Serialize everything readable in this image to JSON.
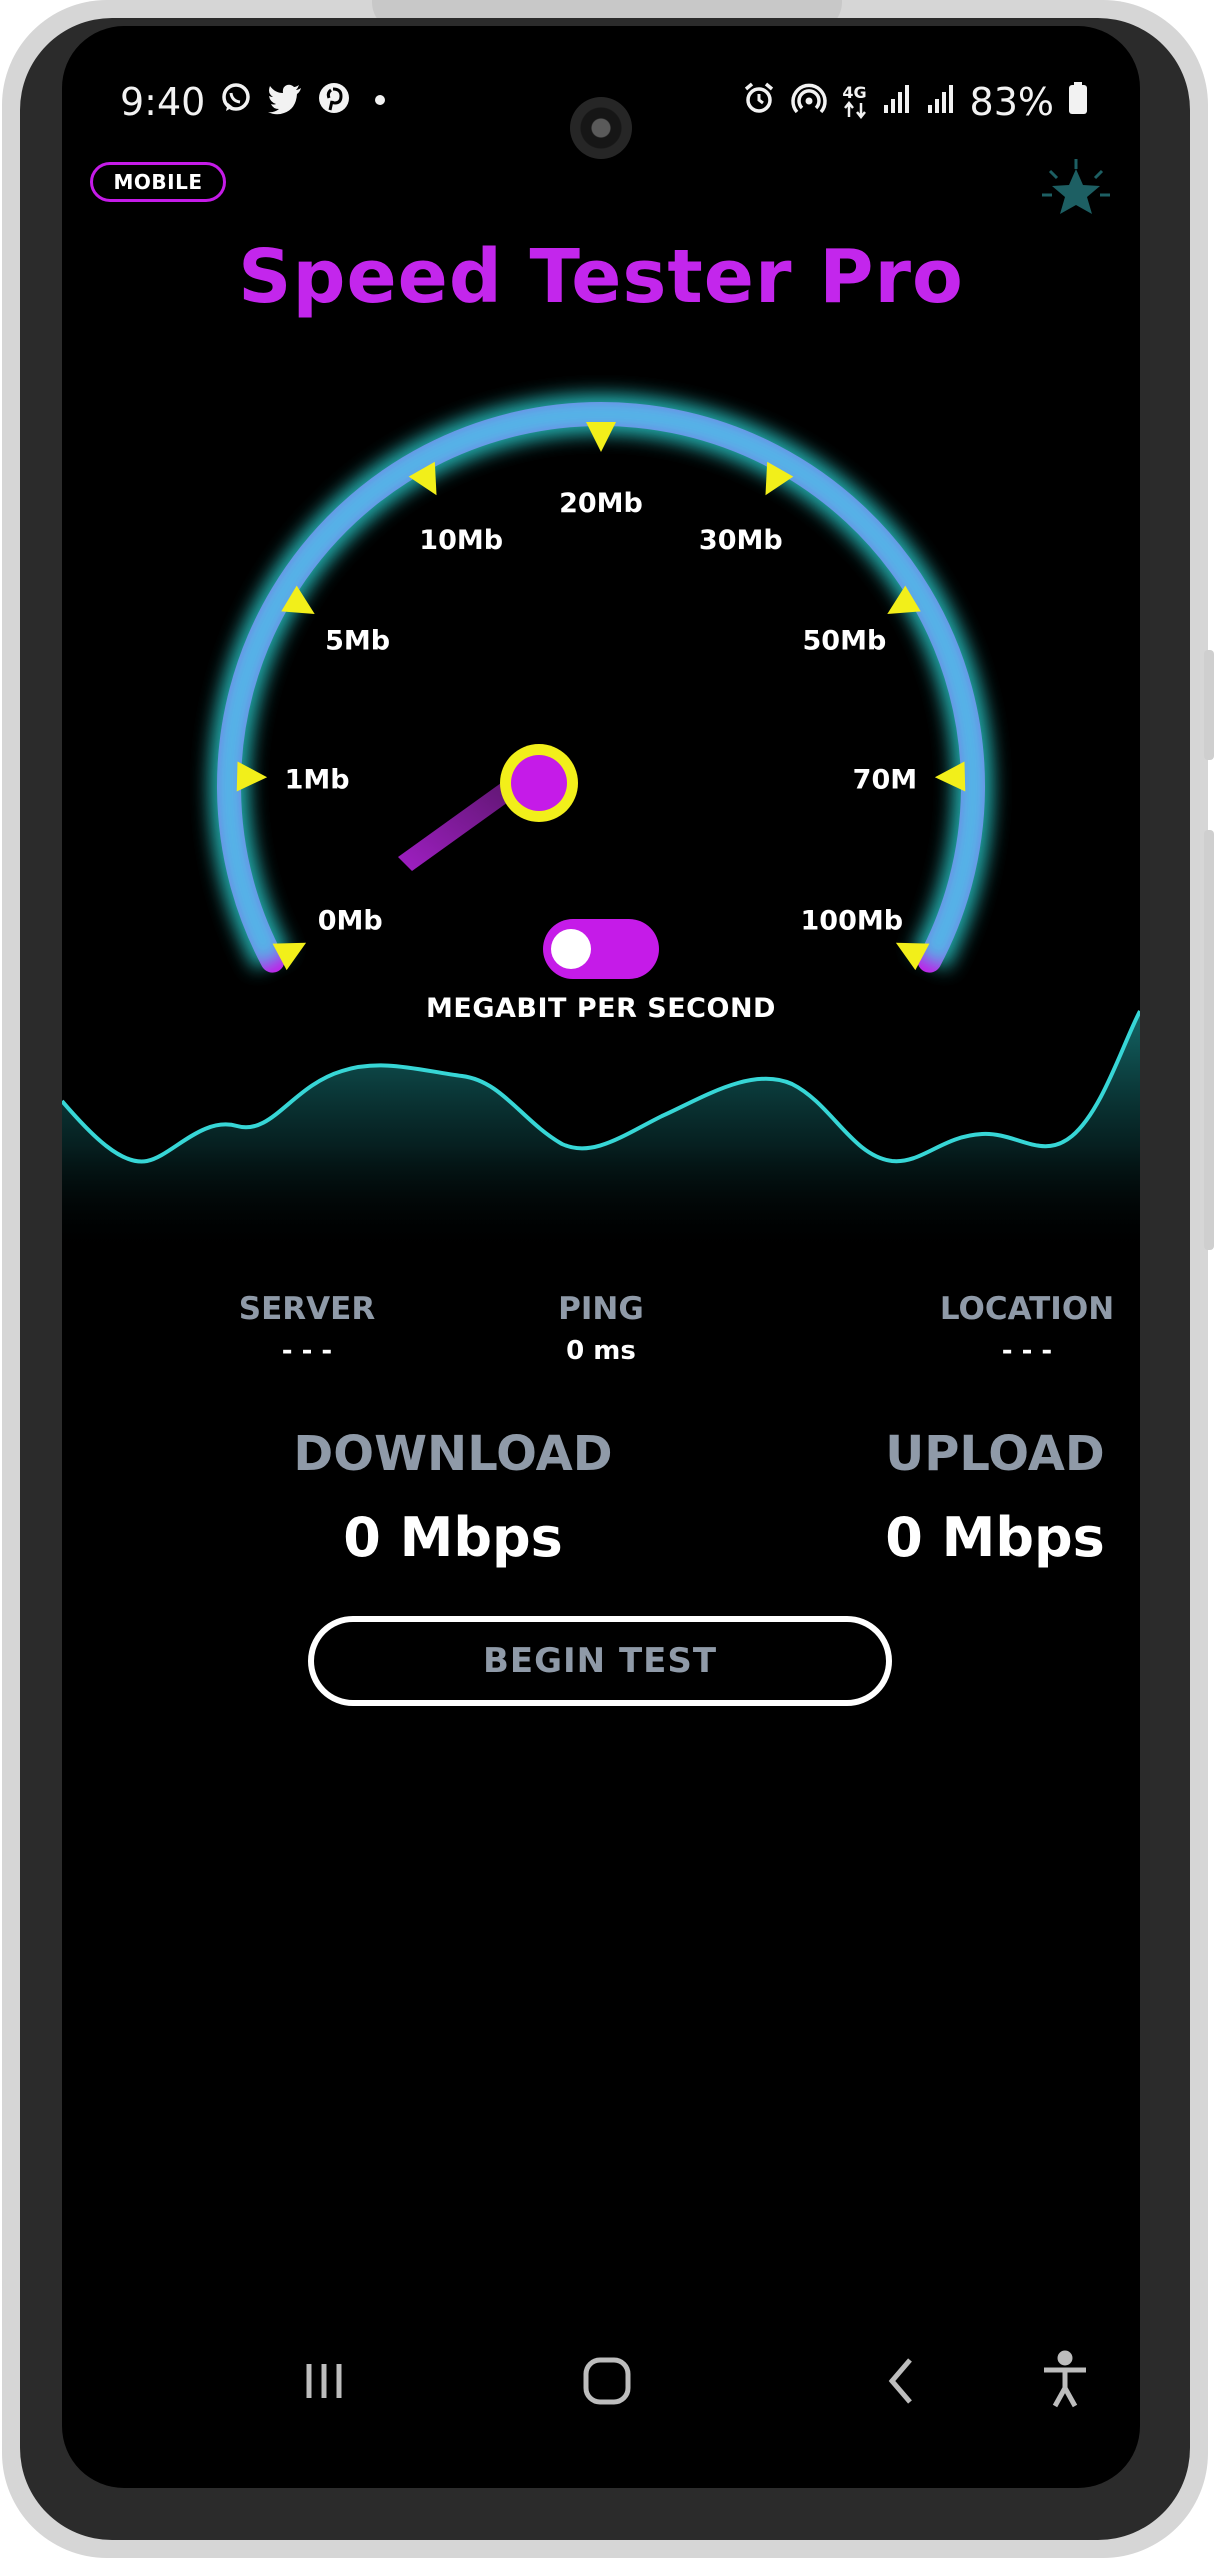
{
  "status_bar": {
    "time": "9:40",
    "left_icons": [
      "whatsapp-icon",
      "twitter-icon",
      "pinterest-icon",
      "dot-icon"
    ],
    "right_icons": [
      "alarm-icon",
      "hotspot-icon",
      "4g-data-icon",
      "signal-icon",
      "signal-icon",
      "battery-icon"
    ],
    "network": "4G",
    "battery": "83%"
  },
  "header": {
    "mode_badge": "MOBILE",
    "title": "Speed Tester Pro",
    "star_icon": "star-icon"
  },
  "gauge": {
    "scale_labels": [
      "0Mb",
      "1Mb",
      "5Mb",
      "10Mb",
      "20Mb",
      "30Mb",
      "50Mb",
      "70M",
      "100Mb"
    ],
    "current_value": 0,
    "unit_label": "MEGABIT PER SECOND",
    "unit_toggle_on": true,
    "colors": {
      "arc": "#c51be8",
      "glow": "#2ee6e6",
      "ticks": "#f2ef1a",
      "needle": "#8d1fa8",
      "hub": "#c51be8",
      "hub_ring": "#f2ef1a"
    }
  },
  "stats": {
    "server": {
      "label": "SERVER",
      "value": "- - -"
    },
    "ping": {
      "label": "PING",
      "value": "0 ms"
    },
    "location": {
      "label": "LOCATION",
      "value": "- - -"
    }
  },
  "results": {
    "download": {
      "label": "DOWNLOAD",
      "value": "0 Mbps"
    },
    "upload": {
      "label": "UPLOAD",
      "value": "0 Mbps"
    }
  },
  "actions": {
    "begin_test": "BEGIN TEST"
  },
  "nav_bar": {
    "items": [
      "recents-icon",
      "home-icon",
      "back-icon",
      "accessibility-icon"
    ]
  }
}
